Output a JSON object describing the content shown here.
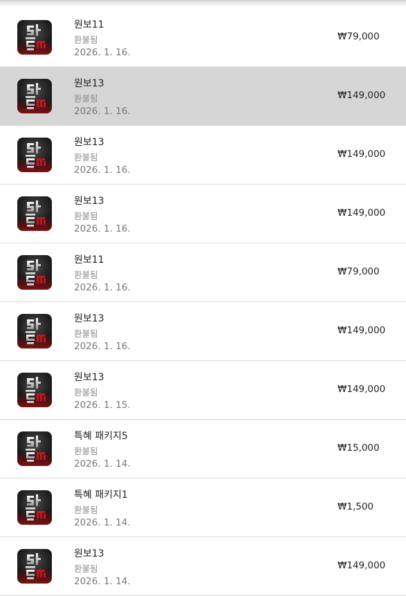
{
  "purchases": [
    {
      "title": "원보11",
      "status": "환불됨",
      "date": "2026. 1. 16.",
      "price": "₩79,000",
      "selected": false,
      "icon": "lineage-app-icon"
    },
    {
      "title": "원보13",
      "status": "환불됨",
      "date": "2026. 1. 16.",
      "price": "₩149,000",
      "selected": true,
      "icon": "lineage-app-icon"
    },
    {
      "title": "원보13",
      "status": "환불됨",
      "date": "2026. 1. 16.",
      "price": "₩149,000",
      "selected": false,
      "icon": "lineage-app-icon"
    },
    {
      "title": "원보13",
      "status": "환불됨",
      "date": "2026. 1. 16.",
      "price": "₩149,000",
      "selected": false,
      "icon": "lineage-app-icon"
    },
    {
      "title": "원보11",
      "status": "환불됨",
      "date": "2026. 1. 16.",
      "price": "₩79,000",
      "selected": false,
      "icon": "lineage-app-icon"
    },
    {
      "title": "원보13",
      "status": "환불됨",
      "date": "2026. 1. 16.",
      "price": "₩149,000",
      "selected": false,
      "icon": "lineage-app-icon"
    },
    {
      "title": "원보13",
      "status": "환불됨",
      "date": "2026. 1. 15.",
      "price": "₩149,000",
      "selected": false,
      "icon": "lineage-app-icon"
    },
    {
      "title": "특혜 패키지5",
      "status": "환불됨",
      "date": "2026. 1. 14.",
      "price": "₩15,000",
      "selected": false,
      "icon": "lineage-app-icon"
    },
    {
      "title": "특혜 패키지1",
      "status": "환불됨",
      "date": "2026. 1. 14.",
      "price": "₩1,500",
      "selected": false,
      "icon": "lineage-app-icon"
    },
    {
      "title": "원보13",
      "status": "환불됨",
      "date": "2026. 1. 14.",
      "price": "₩149,000",
      "selected": false,
      "icon": "lineage-app-icon"
    }
  ],
  "colors": {
    "selected_row_bg": "#d6d6d6",
    "divider": "#dcdcdc",
    "icon_accent_red": "#b3121b"
  }
}
